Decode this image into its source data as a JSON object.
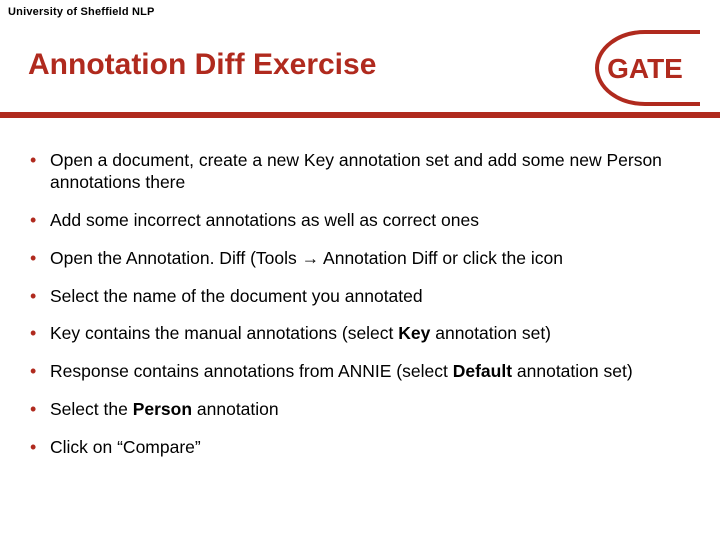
{
  "header": {
    "org_label": "University of Sheffield NLP"
  },
  "title": "Annotation Diff Exercise",
  "logo": {
    "text": "GATE",
    "color_text": "#B02A1E",
    "color_stroke": "#B02A1E"
  },
  "bullets": [
    {
      "segments": [
        {
          "text": "Open a document, create a new Key annotation set and add some new Person annotations there",
          "bold": false
        }
      ]
    },
    {
      "segments": [
        {
          "text": "Add some incorrect annotations as well as correct ones",
          "bold": false
        }
      ]
    },
    {
      "segments": [
        {
          "text": "Open the Annotation. Diff (Tools → Annotation Diff or click the icon",
          "bold": false
        }
      ]
    },
    {
      "segments": [
        {
          "text": "Select the name of the document you annotated",
          "bold": false
        }
      ]
    },
    {
      "segments": [
        {
          "text": "Key contains the manual annotations (select ",
          "bold": false
        },
        {
          "text": "Key",
          "bold": true
        },
        {
          "text": " annotation set)",
          "bold": false
        }
      ]
    },
    {
      "segments": [
        {
          "text": "Response contains annotations from ANNIE (select ",
          "bold": false
        },
        {
          "text": "Default",
          "bold": true
        },
        {
          "text": " annotation set)",
          "bold": false
        }
      ]
    },
    {
      "segments": [
        {
          "text": "Select the ",
          "bold": false
        },
        {
          "text": "Person",
          "bold": true
        },
        {
          "text": " annotation",
          "bold": false
        }
      ]
    },
    {
      "segments": [
        {
          "text": "Click on “Compare”",
          "bold": false
        }
      ]
    }
  ]
}
